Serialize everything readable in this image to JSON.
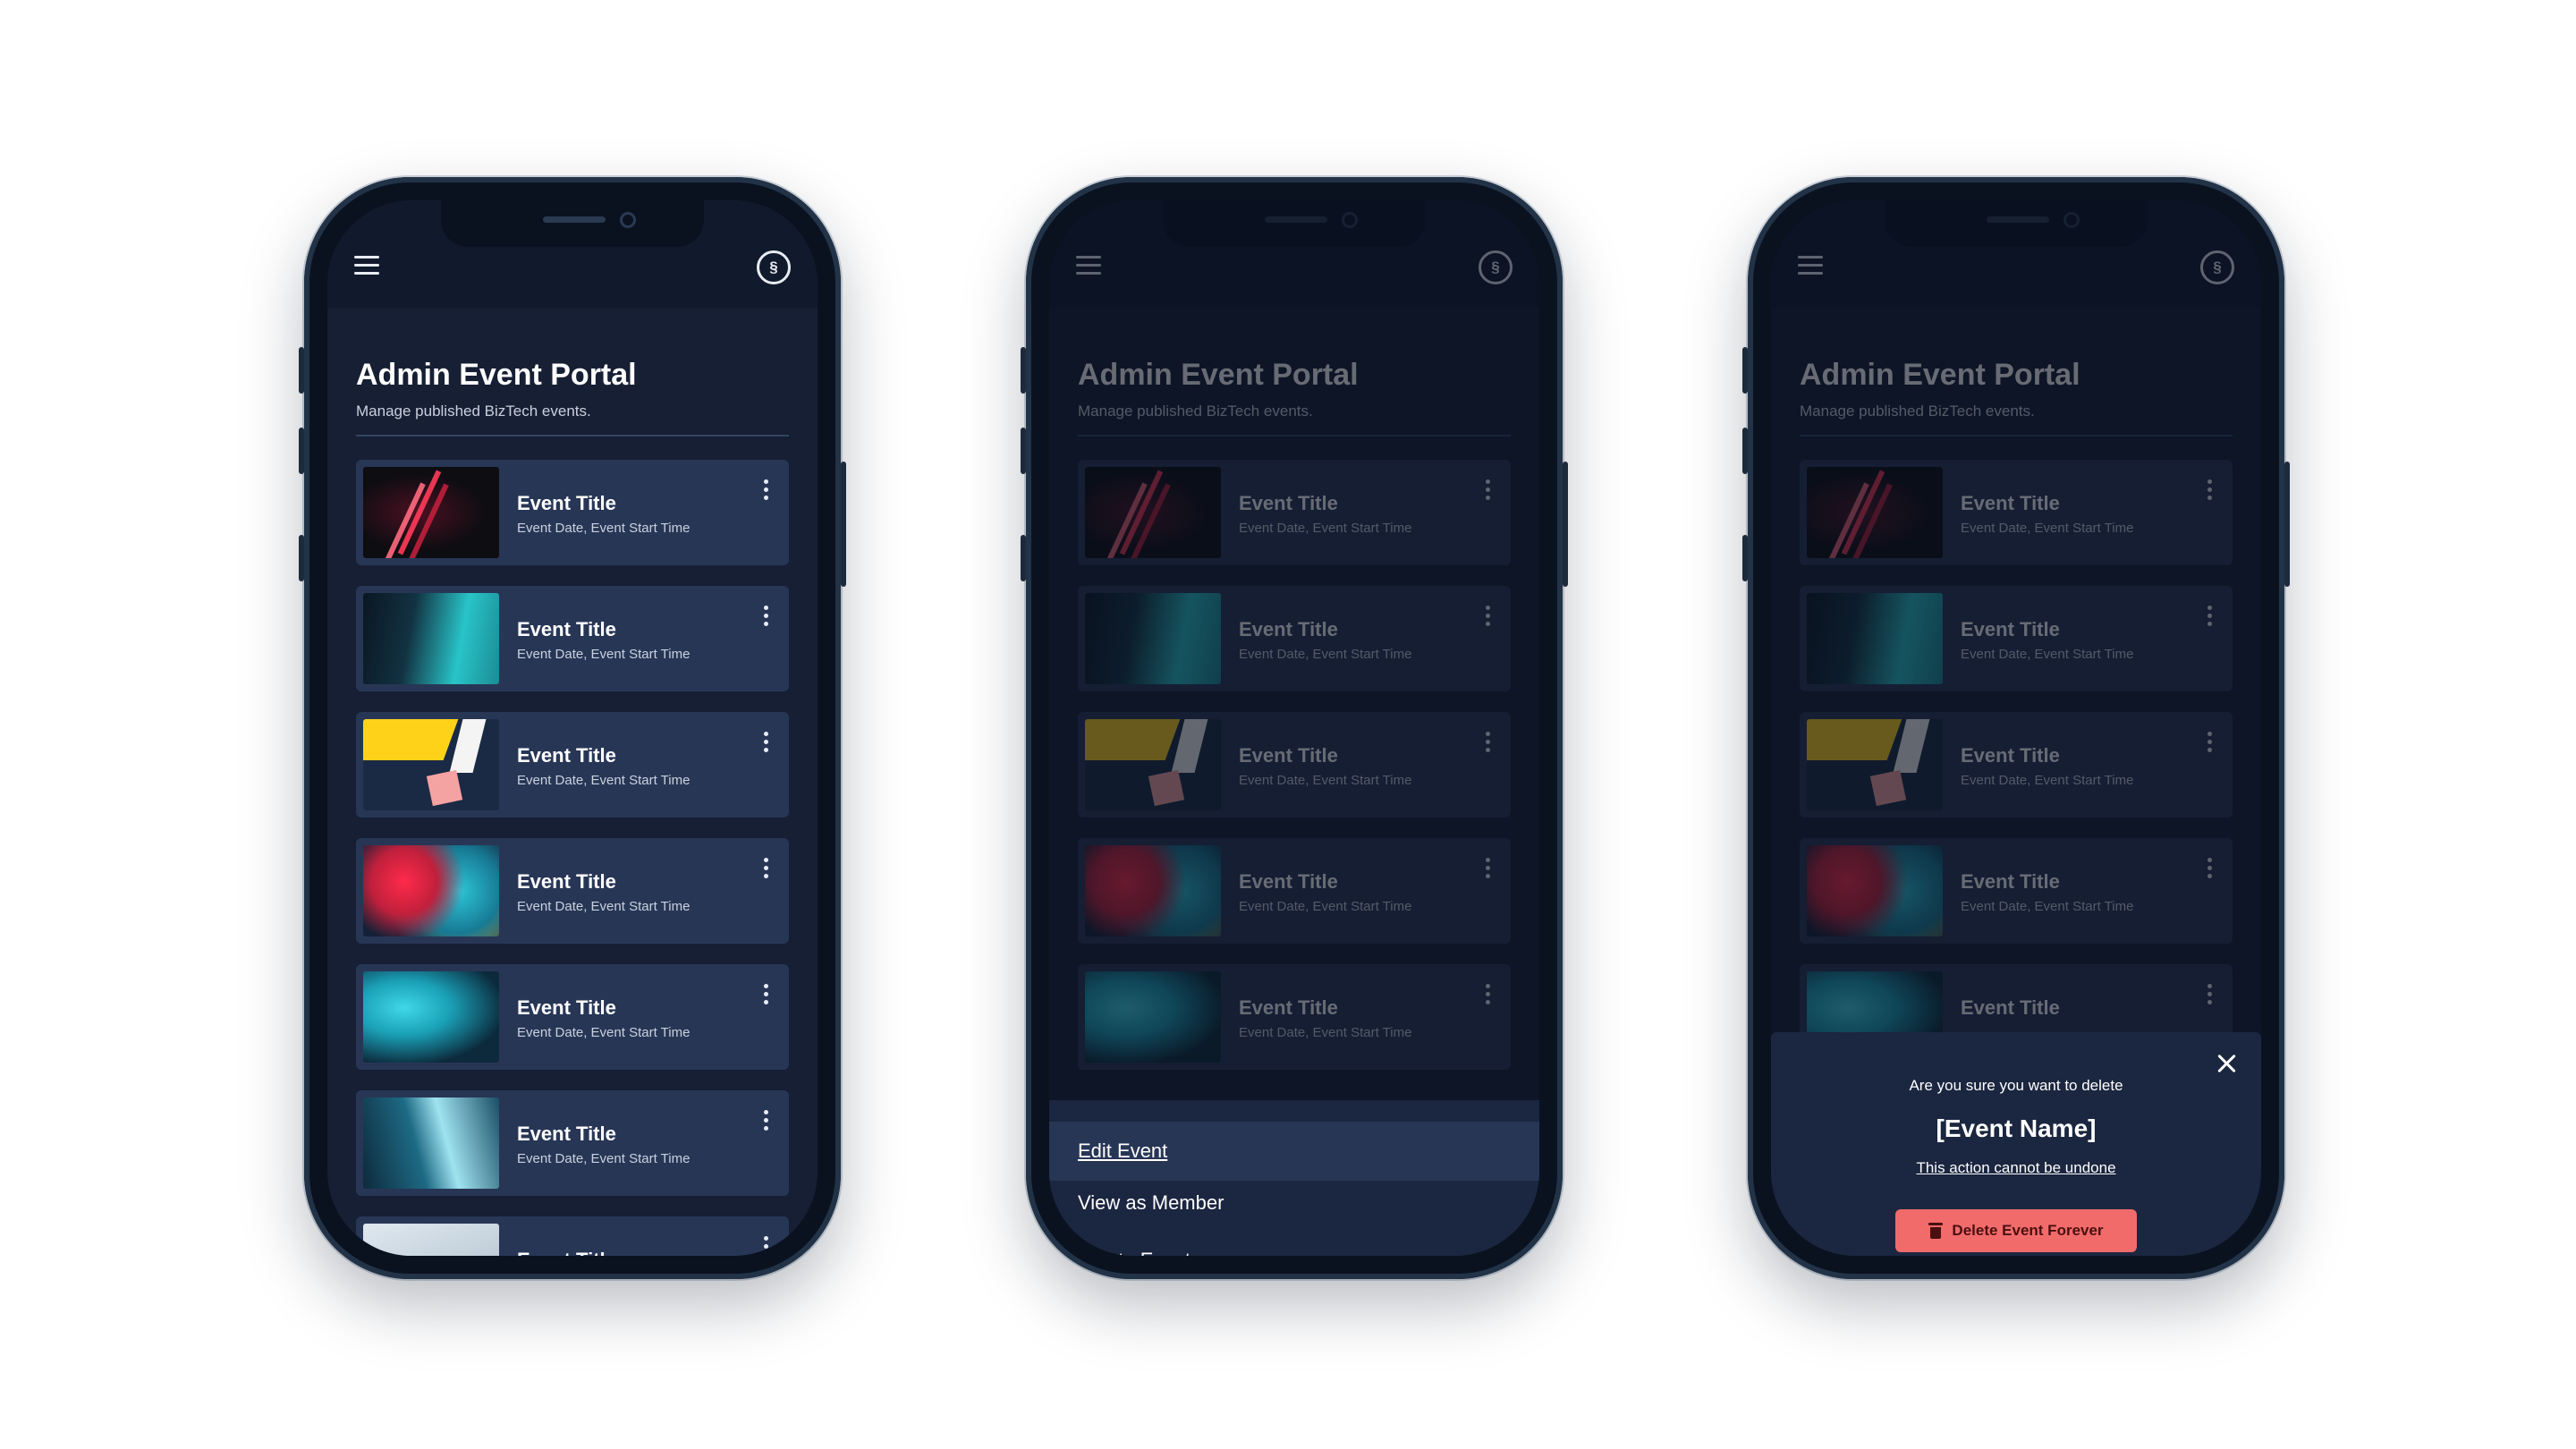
{
  "app": {
    "title": "Admin Event Portal",
    "subtitle": "Manage published BizTech events.",
    "profile_glyph": "§"
  },
  "events": [
    {
      "title": "Event Title",
      "subtitle": "Event Date, Event Start Time"
    },
    {
      "title": "Event Title",
      "subtitle": "Event Date, Event Start Time"
    },
    {
      "title": "Event Title",
      "subtitle": "Event Date, Event Start Time"
    },
    {
      "title": "Event Title",
      "subtitle": "Event Date, Event Start Time"
    },
    {
      "title": "Event Title",
      "subtitle": "Event Date, Event Start Time"
    },
    {
      "title": "Event Title",
      "subtitle": "Event Date, Event Start Time"
    },
    {
      "title": "Event Title",
      "subtitle": ""
    }
  ],
  "context_menu": {
    "items": [
      "Edit Event",
      "View as Member",
      "Delete Event"
    ]
  },
  "delete_modal": {
    "question": "Are you sure you want to delete",
    "event_name": "[Event Name]",
    "warning": "This action cannot be undone",
    "button_label": "Delete Event Forever"
  },
  "colors": {
    "page_bg": "#ffffff",
    "screen_bg": "#161f33",
    "card_bg": "#283656",
    "danger": "#f26b6b"
  },
  "icons": [
    "menu-icon",
    "profile-icon",
    "kebab-icon",
    "close-icon",
    "trash-icon"
  ]
}
